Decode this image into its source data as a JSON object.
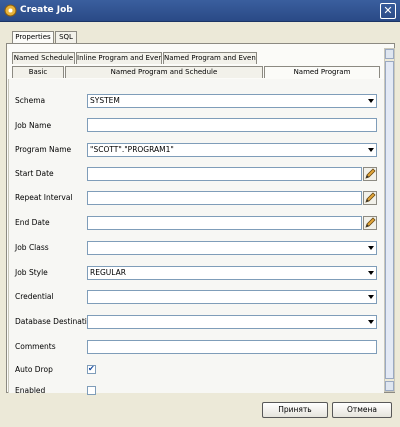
{
  "window": {
    "title": "Create Job",
    "close_glyph": "✕"
  },
  "top_tabs": [
    {
      "label": "Properties"
    },
    {
      "label": "SQL"
    }
  ],
  "sub_tabs_row1": [
    {
      "label": "Named Schedule"
    },
    {
      "label": "Inline Program and Event"
    },
    {
      "label": "Named Program and Event"
    }
  ],
  "sub_tabs_row2": [
    {
      "label": "Basic"
    },
    {
      "label": "Named Program and Schedule"
    },
    {
      "label": "Named Program"
    }
  ],
  "form": {
    "schema": {
      "label": "Schema",
      "value": "SYSTEM"
    },
    "job_name": {
      "label": "Job Name",
      "value": ""
    },
    "program_name": {
      "label": "Program Name",
      "value": "\"SCOTT\".\"PROGRAM1\""
    },
    "start_date": {
      "label": "Start Date",
      "value": ""
    },
    "repeat_interval": {
      "label": "Repeat Interval",
      "value": ""
    },
    "end_date": {
      "label": "End Date",
      "value": ""
    },
    "job_class": {
      "label": "Job Class",
      "value": ""
    },
    "job_style": {
      "label": "Job Style",
      "value": "REGULAR"
    },
    "credential": {
      "label": "Credential",
      "value": ""
    },
    "database_destination": {
      "label": "Database Destination",
      "value": ""
    },
    "comments": {
      "label": "Comments",
      "value": ""
    },
    "auto_drop": {
      "label": "Auto Drop",
      "checked": true
    },
    "enabled": {
      "label": "Enabled",
      "checked": false
    }
  },
  "buttons": {
    "apply": "Принять",
    "cancel": "Отмена"
  },
  "colors": {
    "titlebar": "#2a4a86",
    "accent_check": "#1c4ea0",
    "field_border": "#7f9db9"
  }
}
